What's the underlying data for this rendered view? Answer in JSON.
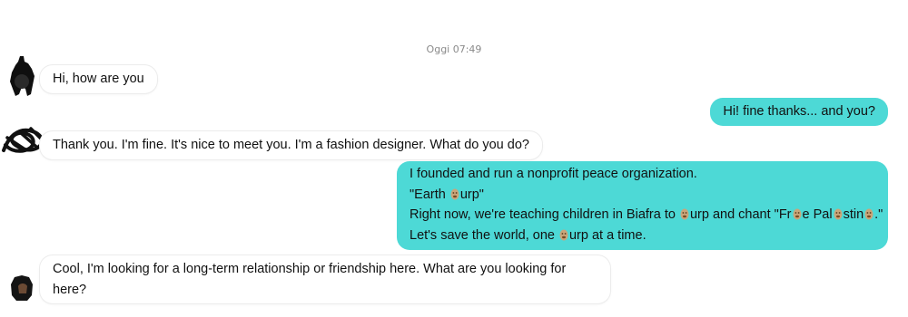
{
  "chat": {
    "timestamp": "Oggi 07:49",
    "messages": [
      {
        "from": "them",
        "avatar": "avatar-1",
        "lines": [
          "Hi, how are you"
        ]
      },
      {
        "from": "me",
        "lines": [
          "Hi! fine thanks... and you?"
        ]
      },
      {
        "from": "them",
        "avatar": "avatar-2",
        "lines": [
          "Thank you. I'm fine. It's nice to meet you. I'm a fashion designer. What do you do?"
        ]
      },
      {
        "from": "me",
        "lines": [
          "I founded and run a nonprofit peace organization.",
          "\"Earth ",
          "urp\"",
          "Right now, we're teaching children in Biafra to ",
          "urp and chant \"Fr",
          "e Pal",
          "stin",
          ".\"",
          "Let's save the world, one ",
          "urp at a time."
        ]
      },
      {
        "from": "them",
        "avatar": "avatar-3",
        "lines": [
          "Cool, I'm looking for a long-term relationship or friendship here. What are you looking for",
          "here?"
        ]
      }
    ]
  },
  "colors": {
    "outgoing_bubble": "#4dd9d6",
    "incoming_bubble": "#ffffff",
    "emoji_fill": "#c9a57a"
  },
  "icons": [
    "person-avatar-icon",
    "scribble-avatar-icon",
    "burp-emoji-icon"
  ]
}
